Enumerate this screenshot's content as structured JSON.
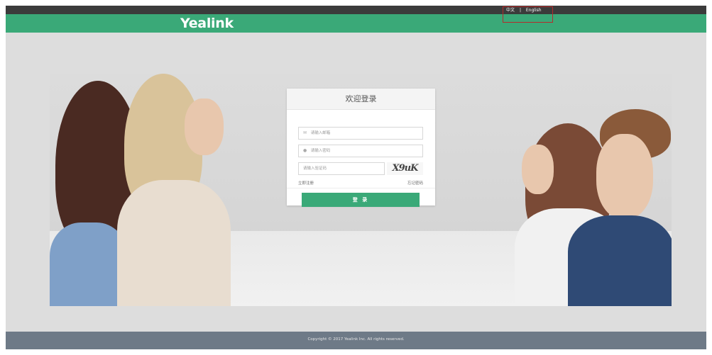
{
  "header": {
    "logo_text": "Yealink",
    "language_zh": "中文",
    "language_sep": "|",
    "language_en": "English"
  },
  "login": {
    "title": "欢迎登录",
    "email_placeholder": "请输入邮箱",
    "email_icon": "mail-icon",
    "password_placeholder": "请输入密码",
    "password_icon": "lock-icon",
    "captcha_placeholder": "请输入验证码",
    "captcha_text": "X9uK",
    "register_link": "立即注册",
    "forgot_link": "忘记密码",
    "submit_label": "登 录"
  },
  "footer": {
    "copyright": "Copyright © 2017 Yealink Inc. All rights reserved."
  },
  "colors": {
    "brand_green": "#3aa978",
    "topbar": "#3b3b3b",
    "footer": "#6e7a87"
  }
}
